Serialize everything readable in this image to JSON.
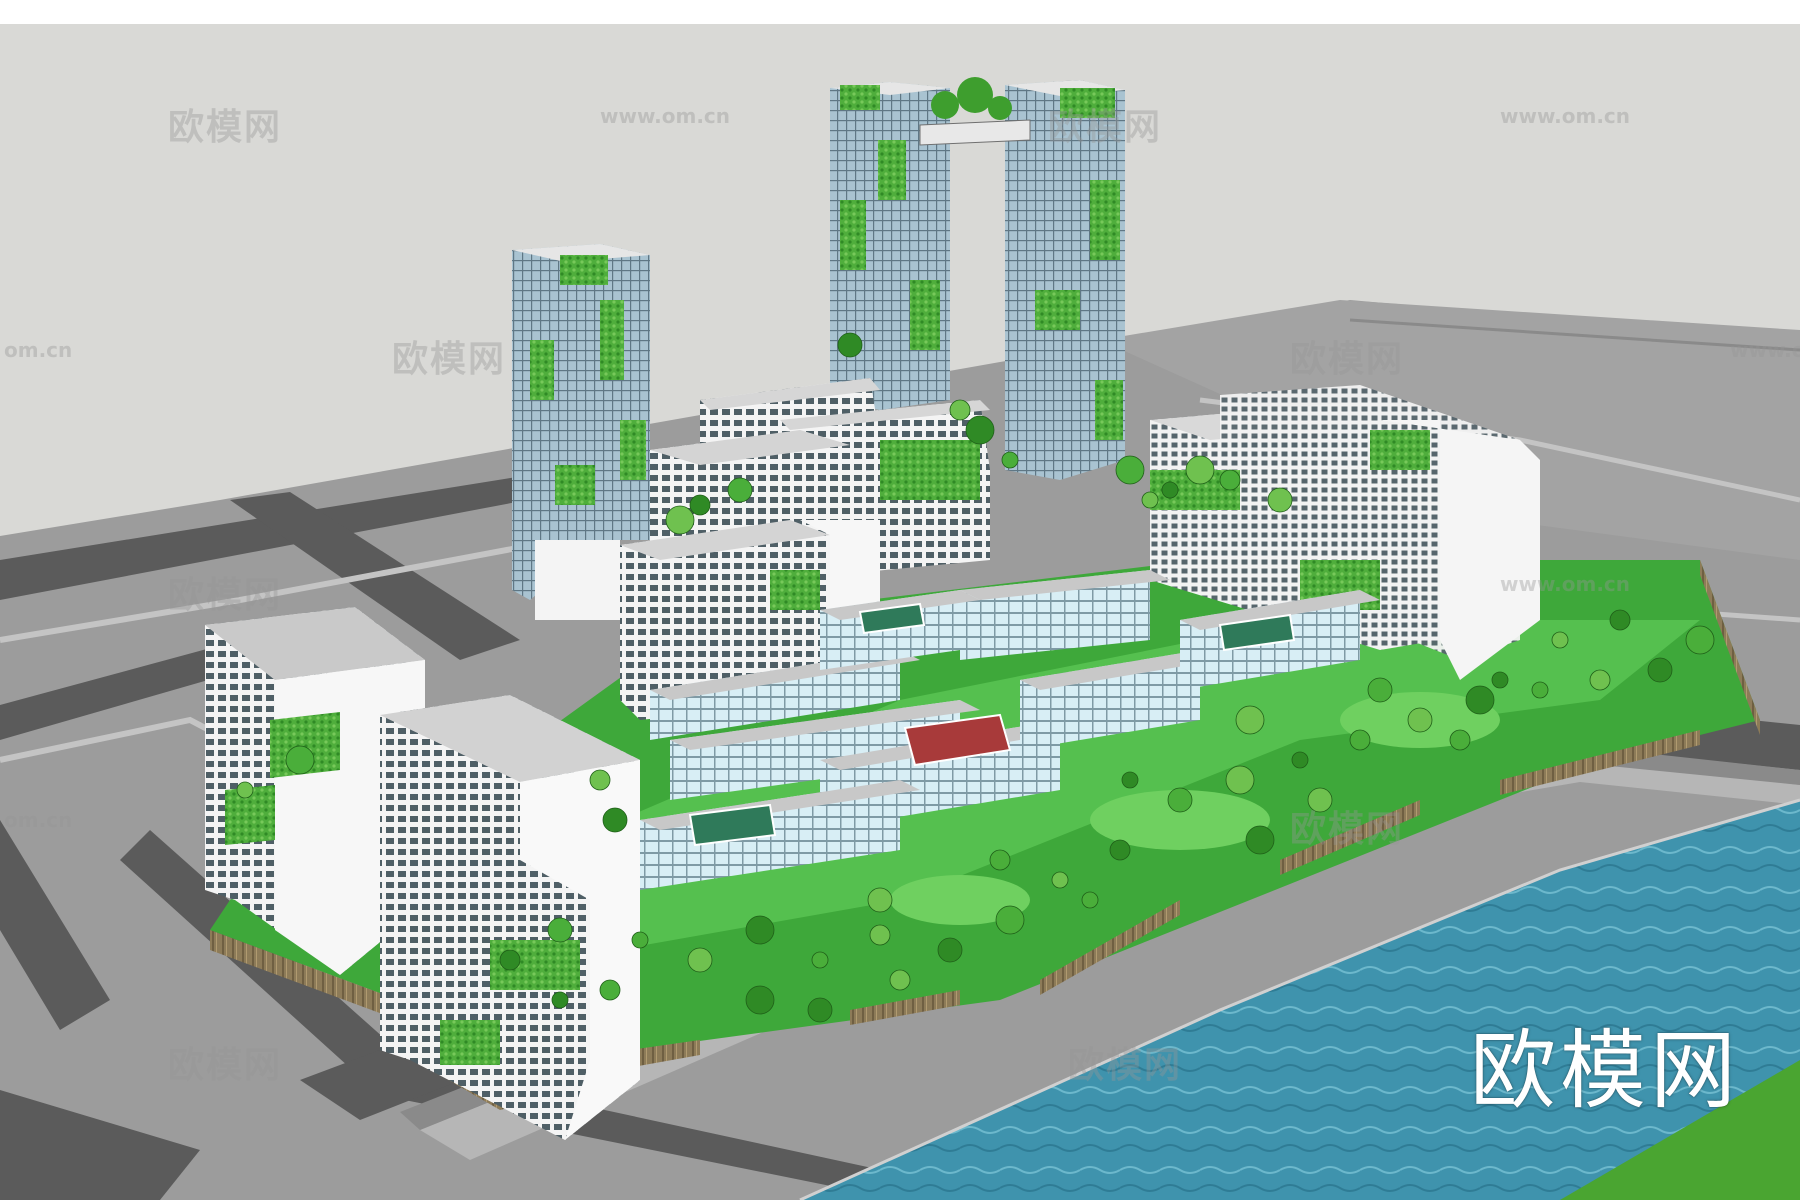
{
  "watermarks": {
    "brand": "欧模网",
    "url": "www.om.cn",
    "url_partial": "om.cn"
  },
  "colors": {
    "sky": "#d9d9d6",
    "top_bar": "#ffffff",
    "ground": "#9b9b9b",
    "road": "#5c5c5c",
    "sidewalk": "#b8b8b8",
    "grass": "#3aa33a",
    "grass_light": "#5ec95a",
    "water": "#3c8fa8",
    "water_light": "#5fb0c4",
    "facade": "#ffffff",
    "glass": "#9fb8c8",
    "roof": "#bfbfbf",
    "tree": "#3e9e2e",
    "cliff": "#8a7a5a"
  },
  "scene": {
    "description_icon": "aerial-3d-model",
    "building_icons": [
      "tower-icon",
      "slab-building-icon",
      "terrace-icon",
      "tennis-court-icon",
      "tree-icon"
    ]
  }
}
